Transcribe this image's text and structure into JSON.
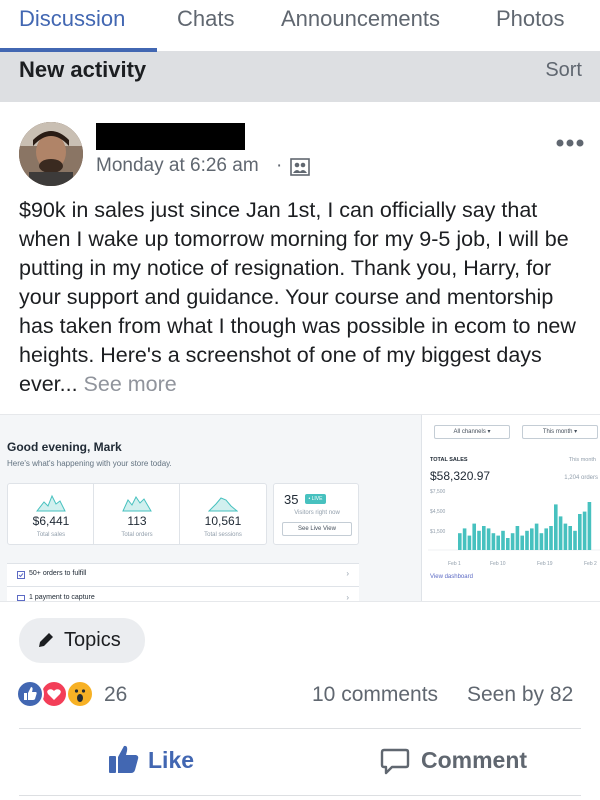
{
  "tabs": [
    {
      "label": "Discussion",
      "active": true
    },
    {
      "label": "Chats"
    },
    {
      "label": "Announcements"
    },
    {
      "label": "Photos"
    }
  ],
  "section": {
    "title": "New activity",
    "sort_label": "Sort"
  },
  "post": {
    "time": "Monday at 6:26 am",
    "separator": "·",
    "body": "$90k in sales just since Jan 1st, I can officially say that when I wake up tomorrow morning for my 9-5 job, I will be putting in my notice of resignation. Thank you, Harry, for your support and guidance. Your course and mentorship has taken from what I though was possible in ecom to new heights. Here's a screenshot of one of my biggest days ever... ",
    "see_more": "See more"
  },
  "shot": {
    "greeting": "Good evening, Mark",
    "subtitle": "Here's what's happening with your store today.",
    "stats": [
      {
        "value": "$6,441",
        "label": "Total sales"
      },
      {
        "value": "113",
        "label": "Total orders"
      },
      {
        "value": "10,561",
        "label": "Total sessions"
      }
    ],
    "live": {
      "count": "35",
      "badge": "• LIVE",
      "sub": "Visitors right now",
      "button": "See Live View"
    },
    "tasks": [
      "50+ orders to fulfill",
      "1 payment to capture"
    ],
    "channel_dropdown": "All channels ▾",
    "period_dropdown": "This month ▾",
    "sales_title": "TOTAL SALES",
    "sales_period": "This month",
    "sales_amount": "$58,320.97",
    "sales_orders": "1,204 orders",
    "y_ticks": [
      "$7,500",
      "$4,500",
      "$1,500"
    ],
    "x_ticks": [
      "Feb 1",
      "Feb 10",
      "Feb 19",
      "Feb 2"
    ],
    "view_dashboard": "View dashboard",
    "chart_bars": [
      0.35,
      0.45,
      0.3,
      0.55,
      0.4,
      0.5,
      0.45,
      0.35,
      0.3,
      0.4,
      0.25,
      0.35,
      0.5,
      0.3,
      0.4,
      0.45,
      0.55,
      0.35,
      0.45,
      0.5,
      0.95,
      0.7,
      0.55,
      0.5,
      0.4,
      0.75,
      0.8,
      1.0
    ],
    "accent": "#47c1bf"
  },
  "topics": {
    "label": "Topics"
  },
  "reactions": {
    "count": "26",
    "comments": "10 comments",
    "seen_by": "Seen by 82"
  },
  "actions": {
    "like": "Like",
    "comment": "Comment"
  },
  "colors": {
    "facebook_blue": "#4267b2",
    "reaction_red": "#f33e58",
    "reaction_yellow": "#f7b125"
  }
}
